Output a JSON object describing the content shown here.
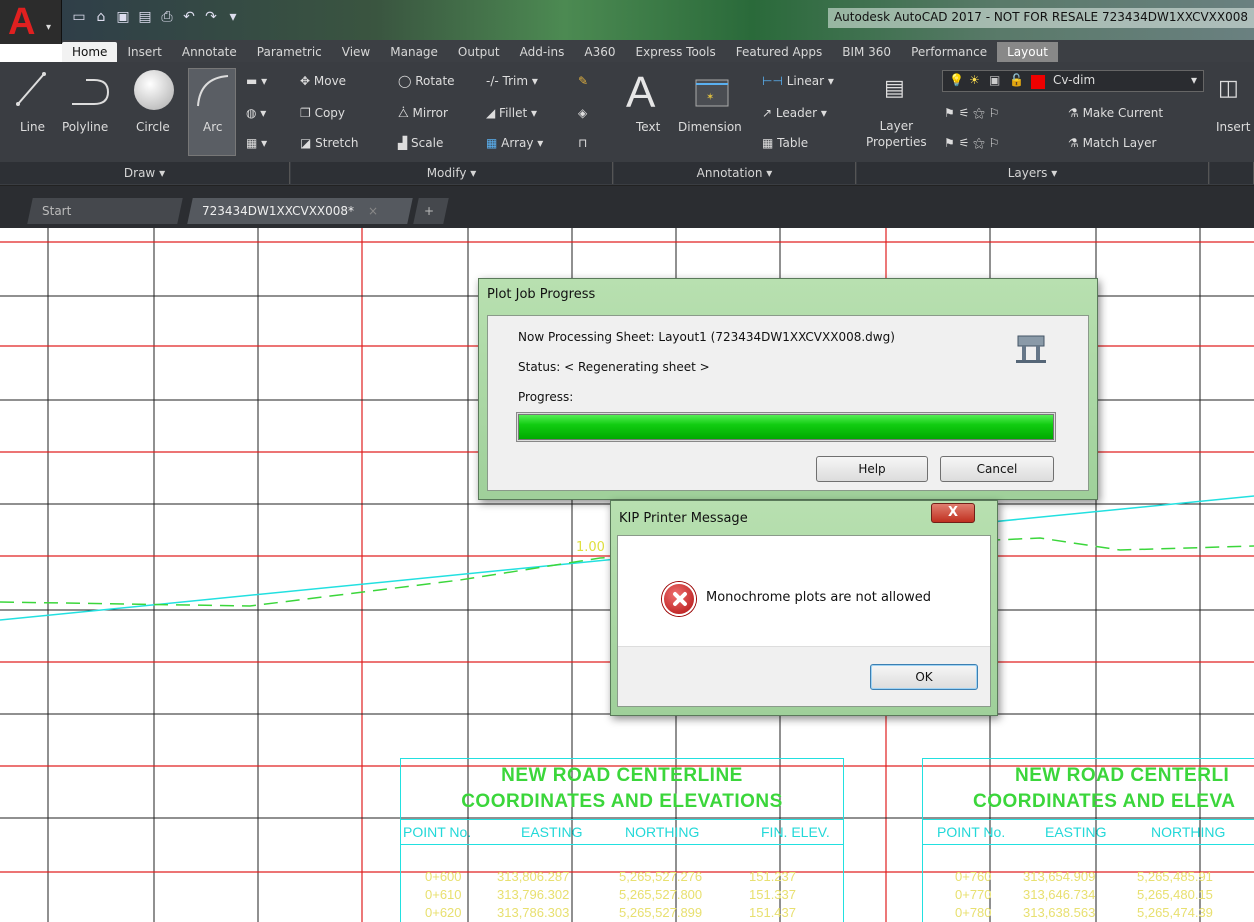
{
  "window": {
    "title": "Autodesk AutoCAD 2017 - NOT FOR RESALE   723434DW1XXCVXX008"
  },
  "ribbon_tabs": [
    "Home",
    "Insert",
    "Annotate",
    "Parametric",
    "View",
    "Manage",
    "Output",
    "Add-ins",
    "A360",
    "Express Tools",
    "Featured Apps",
    "BIM 360",
    "Performance",
    "Layout"
  ],
  "draw": {
    "line": "Line",
    "polyline": "Polyline",
    "circle": "Circle",
    "arc": "Arc",
    "panel": "Draw ▾"
  },
  "modify": {
    "move": "Move",
    "rotate": "Rotate",
    "trim": "Trim",
    "copy": "Copy",
    "mirror": "Mirror",
    "fillet": "Fillet",
    "stretch": "Stretch",
    "scale": "Scale",
    "array": "Array",
    "panel": "Modify ▾"
  },
  "annotation": {
    "text": "Text",
    "dimension": "Dimension",
    "linear": "Linear",
    "leader": "Leader",
    "table": "Table",
    "panel": "Annotation ▾"
  },
  "layers": {
    "layer_properties": "Layer\nProperties",
    "current_layer": "Cv-dim",
    "make_current": "Make Current",
    "match_layer": "Match Layer",
    "panel": "Layers ▾"
  },
  "insert": {
    "label": "Insert"
  },
  "doc_tabs": {
    "start": "Start",
    "active": "723434DW1XXCVXX008*",
    "close": "×",
    "add": "+"
  },
  "plot_dialog": {
    "title": "Plot Job Progress",
    "line1": "Now Processing Sheet: Layout1 (723434DW1XXCVXX008.dwg)",
    "status": "Status: < Regenerating sheet >",
    "progress_label": "Progress:",
    "progress": 1.0,
    "help": "Help",
    "cancel": "Cancel"
  },
  "kip_dialog": {
    "title": "KIP Printer Message",
    "message": "Monochrome plots are not allowed",
    "ok": "OK",
    "close": "X"
  },
  "drawing": {
    "slope_label": "1.00",
    "table1": {
      "title1": "NEW ROAD CENTERLINE",
      "title2": "COORDINATES AND ELEVATIONS",
      "headers": [
        "POINT No.",
        "EASTING",
        "NORTHING",
        "FIN. ELEV."
      ],
      "rows": [
        [
          "0+600",
          "313,806.287",
          "5,265,527.276",
          "151.237"
        ],
        [
          "0+610",
          "313,796.302",
          "5,265,527.800",
          "151.337"
        ],
        [
          "0+620",
          "313,786.303",
          "5,265,527.899",
          "151.437"
        ]
      ]
    },
    "table2": {
      "title1": "NEW ROAD CENTERLI",
      "title2": "COORDINATES AND ELEVA",
      "headers": [
        "POINT No.",
        "EASTING",
        "NORTHING"
      ],
      "rows": [
        [
          "0+760",
          "313,654.909",
          "5,265,485.91"
        ],
        [
          "0+770",
          "313,646.734",
          "5,265,480.15"
        ],
        [
          "0+780",
          "313,638.563",
          "5,265,474.39"
        ]
      ]
    }
  },
  "colors": {
    "grid_red": "#e02020",
    "grid_black": "#222222",
    "cyan": "#22e0e0",
    "green_dash": "#3bd63b",
    "progress_green": "#00c000"
  }
}
